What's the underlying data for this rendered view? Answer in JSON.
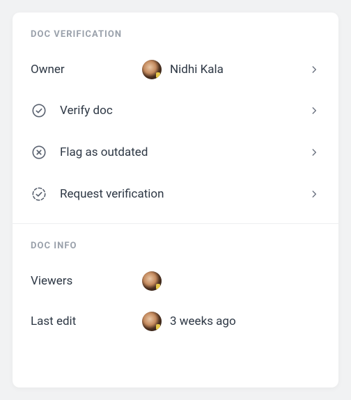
{
  "verification": {
    "header": "DOC VERIFICATION",
    "owner": {
      "key": "Owner",
      "name": "Nidhi Kala"
    },
    "actions": {
      "verify": "Verify doc",
      "flag": "Flag as outdated",
      "request": "Request verification"
    }
  },
  "info": {
    "header": "DOC INFO",
    "viewers": {
      "key": "Viewers"
    },
    "lastEdit": {
      "key": "Last edit",
      "value": "3 weeks ago"
    }
  }
}
